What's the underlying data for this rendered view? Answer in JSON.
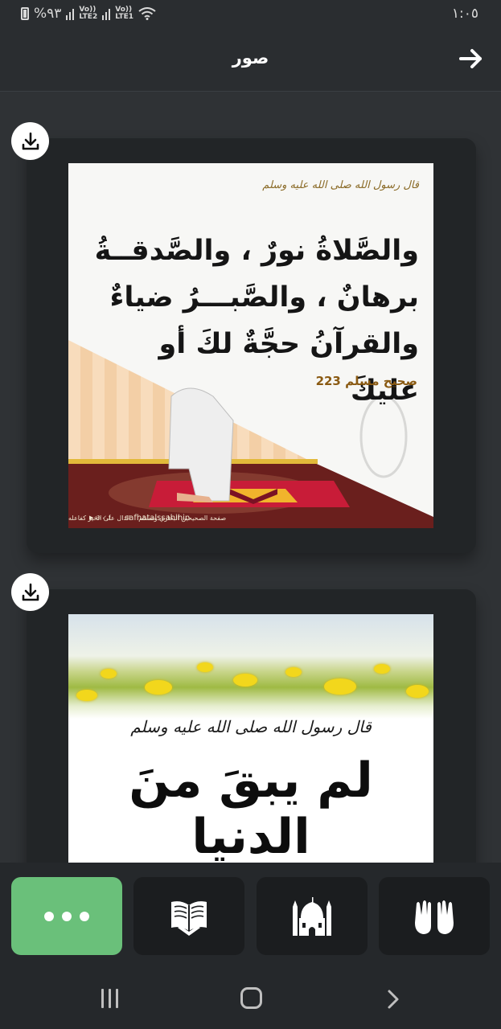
{
  "status_bar": {
    "battery": "%٩٣",
    "sim1": "Vo))\nLTE2",
    "sim2": "Vo))\nLTE1",
    "time": "١:٠٥"
  },
  "header": {
    "title": "صور",
    "back_icon": "arrow-right-icon"
  },
  "cards": [
    {
      "download_icon": "download-icon",
      "image": {
        "attribution": "قال رسول الله صلى الله عليه وسلم",
        "lines": [
          "والصَّلاةُ نورٌ ، والصَّدقــةُ",
          "برهانٌ ، والصَّبـــرُ ضياءٌ",
          "والقرآنُ حجَّةٌ لكَ أو عليكَ"
        ],
        "source": "صحيح مسلم 223",
        "footer_page": "صفحة الصحيحين البخاري ومسلم",
        "footer_motto": "الدال على الخير كفاعله",
        "footer_handle": "safhatalssahihin"
      }
    },
    {
      "download_icon": "download-icon",
      "image": {
        "attribution": "قال رسول الله صلى الله عليه وسلم",
        "headline": "لم يبقَ منَ الدنيا"
      }
    }
  ],
  "tabbar": {
    "tabs": [
      {
        "name": "more",
        "icon": "more-dots-icon",
        "active": true
      },
      {
        "name": "book",
        "icon": "book-icon",
        "active": false
      },
      {
        "name": "mosque",
        "icon": "mosque-icon",
        "active": false
      },
      {
        "name": "dua",
        "icon": "praying-hands-icon",
        "active": false
      }
    ],
    "active_color": "#6ac07a"
  },
  "system_nav": {
    "recent_icon": "recent-apps-icon",
    "home_icon": "home-icon",
    "back_icon": "chevron-right-icon"
  }
}
